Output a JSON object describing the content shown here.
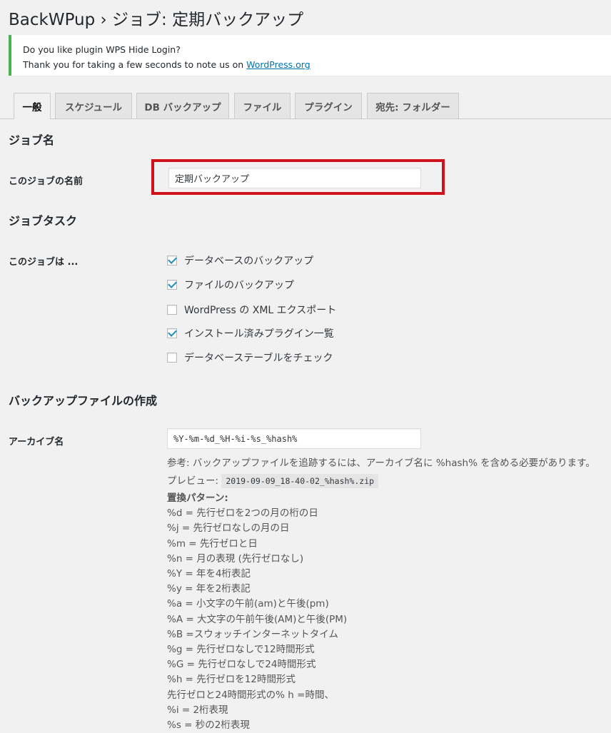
{
  "header": {
    "title": "BackWPup › ジョブ: 定期バックアップ"
  },
  "notice": {
    "line1": "Do you like plugin WPS Hide Login?",
    "line2_prefix": "Thank you for taking a few seconds to note us on ",
    "line2_link": "WordPress.org"
  },
  "tabs": [
    {
      "label": "一般"
    },
    {
      "label": "スケジュール"
    },
    {
      "label": "DB バックアップ"
    },
    {
      "label": "ファイル"
    },
    {
      "label": "プラグイン"
    },
    {
      "label": "宛先: フォルダー"
    }
  ],
  "job_name": {
    "heading": "ジョブ名",
    "label": "このジョブの名前",
    "value": "定期バックアップ"
  },
  "job_tasks": {
    "heading": "ジョブタスク",
    "label": "このジョブは ...",
    "items": [
      {
        "label": "データベースのバックアップ",
        "checked": true
      },
      {
        "label": "ファイルのバックアップ",
        "checked": true
      },
      {
        "label": "WordPress の XML エクスポート",
        "checked": false
      },
      {
        "label": "インストール済みプラグイン一覧",
        "checked": true
      },
      {
        "label": "データベーステーブルをチェック",
        "checked": false
      }
    ]
  },
  "archive": {
    "heading": "バックアップファイルの作成",
    "label": "アーカイブ名",
    "value": "%Y-%m-%d_%H-%i-%s_%hash%",
    "note": "参考: バックアップファイルを追跡するには、アーカイブ名に %hash% を含める必要があります。",
    "preview_label": "プレビュー:",
    "preview_value": "2019-09-09_18-40-02_%hash%.zip",
    "patterns_heading": "置換パターン:",
    "patterns": [
      "%d = 先行ゼロを2つの月の桁の日",
      "%j = 先行ゼロなしの月の日",
      "%m = 先行ゼロと日",
      "%n = 月の表現 (先行ゼロなし)",
      "%Y = 年を4桁表記",
      "%y = 年を2桁表記",
      "%a = 小文字の午前(am)と午後(pm)",
      "%A = 大文字の午前午後(AM)と午後(PM)",
      "%B =スウォッチインターネットタイム",
      "%g = 先行ゼロなしで12時間形式",
      "%G = 先行ゼロなしで24時間形式",
      "%h = 先行ゼロを12時間形式",
      "先行ゼロと24時間形式の% h =時間、",
      "%i = 2桁表現",
      "%s = 秒の2桁表現"
    ]
  },
  "colors": {
    "accent": "#0073aa",
    "notice_border": "#46b450",
    "highlight": "#d0121b",
    "checkmark": "#1e8cbe"
  }
}
